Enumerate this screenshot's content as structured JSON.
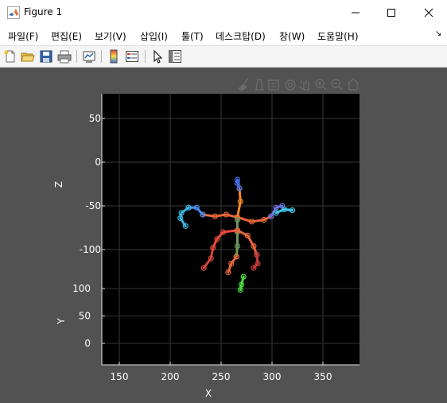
{
  "window": {
    "title": "Figure 1",
    "icon": "matlab-icon"
  },
  "menu": {
    "items": [
      {
        "label": "파일(F)"
      },
      {
        "label": "편집(E)"
      },
      {
        "label": "보기(V)"
      },
      {
        "label": "삽입(I)"
      },
      {
        "label": "툴(T)"
      },
      {
        "label": "데스크탑(D)"
      },
      {
        "label": "창(W)"
      },
      {
        "label": "도움말(H)"
      }
    ],
    "overflow_icon": "dock-arrow-icon"
  },
  "toolbar": {
    "buttons": [
      "new-figure-icon",
      "open-file-icon",
      "save-icon",
      "print-icon",
      "link-plot-icon",
      "insert-colorbar-icon",
      "insert-legend-icon",
      "edit-plot-icon",
      "property-inspector-icon"
    ]
  },
  "axes_toolbar": {
    "buttons": [
      "brush-icon",
      "data-tips-icon",
      "export-icon",
      "rotate-3d-icon",
      "zoom-in-icon",
      "zoom-out-icon",
      "restore-view-icon"
    ]
  },
  "chart_data": {
    "type": "3d-line",
    "title": "",
    "xlabel": "X",
    "ylabel": "Y",
    "zlabel": "Z",
    "x_ticks": [
      "150",
      "200",
      "250",
      "300",
      "350"
    ],
    "y_ticks": [
      "0",
      "50",
      "100"
    ],
    "z_ticks": [
      "50",
      "0",
      "-50",
      "-100"
    ],
    "xlim": [
      133,
      385
    ],
    "grid": true,
    "background": "#000000",
    "axis_color": "#ffffff",
    "series": [
      {
        "color": "#e8673c",
        "points": [
          [
            266,
            -63
          ],
          [
            255,
            -60
          ],
          [
            244,
            -62
          ],
          [
            232,
            -60
          ]
        ]
      },
      {
        "color": "#4a8de8",
        "points": [
          [
            232,
            -60
          ],
          [
            226,
            -52
          ],
          [
            218,
            -52
          ]
        ]
      },
      {
        "color": "#39b6e0",
        "points": [
          [
            218,
            -52
          ],
          [
            211,
            -58
          ],
          [
            210,
            -64
          ],
          [
            215,
            -73
          ]
        ]
      },
      {
        "color": "#f08a2c",
        "points": [
          [
            266,
            -63
          ],
          [
            269,
            -45
          ],
          [
            268,
            -30
          ]
        ]
      },
      {
        "color": "#4a6fe8",
        "points": [
          [
            268,
            -30
          ],
          [
            266,
            -24
          ],
          [
            266,
            -20
          ]
        ]
      },
      {
        "color": "#e8673c",
        "points": [
          [
            266,
            -63
          ],
          [
            280,
            -68
          ],
          [
            292,
            -66
          ],
          [
            299,
            -62
          ]
        ]
      },
      {
        "color": "#6f6fe0",
        "points": [
          [
            299,
            -62
          ],
          [
            304,
            -52
          ],
          [
            310,
            -50
          ]
        ]
      },
      {
        "color": "#3fc8e8",
        "points": [
          [
            304,
            -58
          ],
          [
            312,
            -54
          ],
          [
            320,
            -55
          ]
        ]
      },
      {
        "color": "#6b9a5e",
        "points": [
          [
            266,
            -66
          ],
          [
            266,
            -80
          ],
          [
            266,
            -96
          ],
          [
            265,
            -108
          ]
        ]
      },
      {
        "color": "#e84a3c",
        "points": [
          [
            266,
            -78
          ],
          [
            252,
            -80
          ],
          [
            246,
            -88
          ],
          [
            242,
            -98
          ]
        ]
      },
      {
        "color": "#d4453c",
        "points": [
          [
            242,
            -98
          ],
          [
            240,
            -110
          ],
          [
            233,
            -121
          ]
        ]
      },
      {
        "color": "#e8673c",
        "points": [
          [
            266,
            -78
          ],
          [
            276,
            -84
          ],
          [
            282,
            -96
          ],
          [
            285,
            -106
          ]
        ]
      },
      {
        "color": "#c83c3c",
        "points": [
          [
            285,
            -106
          ],
          [
            286,
            -116
          ],
          [
            282,
            -121
          ]
        ]
      },
      {
        "color": "#e8673c",
        "points": [
          [
            265,
            -108
          ],
          [
            260,
            -116
          ],
          [
            257,
            -126
          ]
        ]
      },
      {
        "color": "#4adc3c",
        "points": [
          [
            272,
            -131
          ],
          [
            270,
            -140
          ],
          [
            269,
            -146
          ]
        ]
      }
    ]
  }
}
